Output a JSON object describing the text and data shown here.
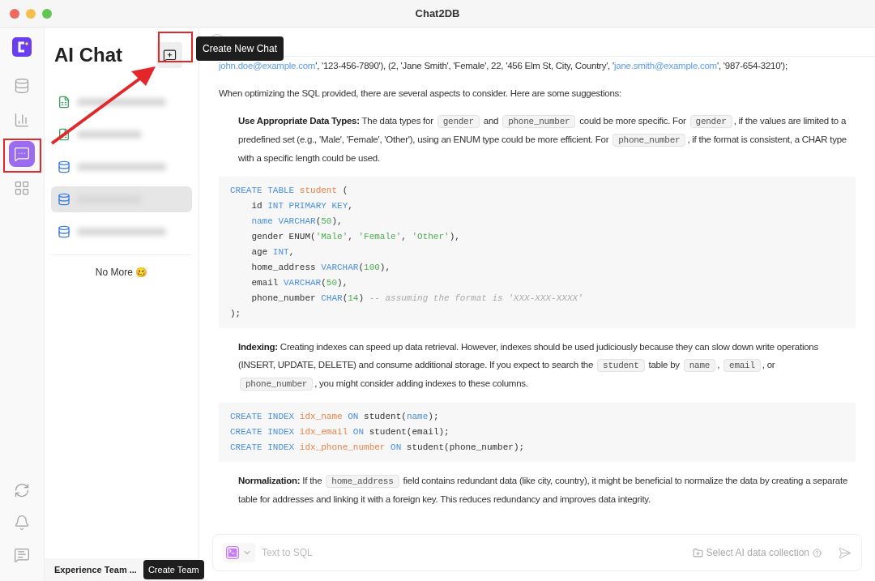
{
  "window": {
    "title": "Chat2DB"
  },
  "rail": {
    "top": [
      {
        "kind": "database",
        "selected": false
      },
      {
        "kind": "dashboard",
        "selected": false
      },
      {
        "kind": "chat",
        "selected": true
      },
      {
        "kind": "apps",
        "selected": false
      }
    ],
    "bottom": [
      {
        "kind": "sync",
        "selected": false
      },
      {
        "kind": "bell",
        "selected": false
      },
      {
        "kind": "feedback",
        "selected": false
      }
    ]
  },
  "sidebar": {
    "title": "AI Chat",
    "new_chat_tooltip": "Create New Chat",
    "items": [
      {
        "kind": "excel",
        "selected": false
      },
      {
        "kind": "excel",
        "selected": false
      },
      {
        "kind": "database",
        "selected": false
      },
      {
        "kind": "database",
        "selected": true
      },
      {
        "kind": "database",
        "selected": false
      }
    ],
    "end_note": "No More 🥴",
    "team": "Experience Team ...",
    "team_tooltip": "Create Team"
  },
  "messages": [
    {
      "kind": "text",
      "indent": false,
      "segments": [
        {
          "kind": "link",
          "text": "john.doe@example.com"
        },
        {
          "kind": "text",
          "text": "', '123-456-7890'), (2, 'Jane Smith', 'Female', 22, '456 Elm St, City, Country', '"
        },
        {
          "kind": "link",
          "text": "jane.smith@example.com"
        },
        {
          "kind": "text",
          "text": "', '987-654-3210');"
        }
      ]
    },
    {
      "kind": "text",
      "indent": false,
      "segments": [
        {
          "kind": "text",
          "text": "When optimizing the SQL provided, there are several aspects to consider. Here are some suggestions:"
        }
      ]
    },
    {
      "kind": "text",
      "indent": true,
      "segments": [
        {
          "kind": "bold",
          "text": "Use Appropriate Data Types:"
        },
        {
          "kind": "text",
          "text": " The data types for "
        },
        {
          "kind": "code",
          "text": "gender"
        },
        {
          "kind": "text",
          "text": " and "
        },
        {
          "kind": "code",
          "text": "phone_number"
        },
        {
          "kind": "text",
          "text": " could be more specific. For "
        },
        {
          "kind": "code",
          "text": "gender"
        },
        {
          "kind": "text",
          "text": ", if the values are limited to a predefined set (e.g., 'Male', 'Female', 'Other'), using an ENUM type could be more efficient. For "
        },
        {
          "kind": "code",
          "text": "phone_number"
        },
        {
          "kind": "text",
          "text": ", if the format is consistent, a CHAR type with a specific length could be used."
        }
      ]
    },
    {
      "kind": "code",
      "lines": [
        [
          {
            "kind": "kw",
            "text": "CREATE TABLE "
          },
          {
            "kind": "name",
            "text": "student"
          },
          {
            "kind": "plain",
            "text": " ("
          }
        ],
        [
          {
            "kind": "plain",
            "text": "    id "
          },
          {
            "kind": "kw",
            "text": "INT PRIMARY KEY"
          },
          {
            "kind": "plain",
            "text": ","
          }
        ],
        [
          {
            "kind": "kw",
            "text": "    name VARCHAR"
          },
          {
            "kind": "plain",
            "text": "("
          },
          {
            "kind": "num",
            "text": "50"
          },
          {
            "kind": "plain",
            "text": "),"
          }
        ],
        [
          {
            "kind": "plain",
            "text": "    gender ENUM("
          },
          {
            "kind": "str",
            "text": "'Male'"
          },
          {
            "kind": "plain",
            "text": ", "
          },
          {
            "kind": "str",
            "text": "'Female'"
          },
          {
            "kind": "plain",
            "text": ", "
          },
          {
            "kind": "str",
            "text": "'Other'"
          },
          {
            "kind": "plain",
            "text": "),"
          }
        ],
        [
          {
            "kind": "plain",
            "text": "    age "
          },
          {
            "kind": "kw",
            "text": "INT"
          },
          {
            "kind": "plain",
            "text": ","
          }
        ],
        [
          {
            "kind": "plain",
            "text": "    home_address "
          },
          {
            "kind": "kw",
            "text": "VARCHAR"
          },
          {
            "kind": "plain",
            "text": "("
          },
          {
            "kind": "num",
            "text": "100"
          },
          {
            "kind": "plain",
            "text": "),"
          }
        ],
        [
          {
            "kind": "plain",
            "text": "    email "
          },
          {
            "kind": "kw",
            "text": "VARCHAR"
          },
          {
            "kind": "plain",
            "text": "("
          },
          {
            "kind": "num",
            "text": "50"
          },
          {
            "kind": "plain",
            "text": "),"
          }
        ],
        [
          {
            "kind": "plain",
            "text": "    phone_number "
          },
          {
            "kind": "kw",
            "text": "CHAR"
          },
          {
            "kind": "plain",
            "text": "("
          },
          {
            "kind": "num",
            "text": "14"
          },
          {
            "kind": "plain",
            "text": ") "
          },
          {
            "kind": "cmt",
            "text": "-- assuming the format is 'XXX-XXX-XXXX'"
          }
        ],
        [
          {
            "kind": "plain",
            "text": ");"
          }
        ]
      ]
    },
    {
      "kind": "text",
      "indent": true,
      "segments": [
        {
          "kind": "bold",
          "text": "Indexing:"
        },
        {
          "kind": "text",
          "text": " Creating indexes can speed up data retrieval. However, indexes should be used judiciously because they can slow down write operations (INSERT, UPDATE, DELETE) and consume additional storage. If you expect to search the "
        },
        {
          "kind": "code",
          "text": "student"
        },
        {
          "kind": "text",
          "text": " table by "
        },
        {
          "kind": "code",
          "text": "name"
        },
        {
          "kind": "text",
          "text": ", "
        },
        {
          "kind": "code",
          "text": "email"
        },
        {
          "kind": "text",
          "text": ", or "
        },
        {
          "kind": "code",
          "text": "phone_number"
        },
        {
          "kind": "text",
          "text": ", you might consider adding indexes to these columns."
        }
      ]
    },
    {
      "kind": "code",
      "lines": [
        [
          {
            "kind": "kw",
            "text": "CREATE INDEX "
          },
          {
            "kind": "name",
            "text": "idx_name"
          },
          {
            "kind": "kw",
            "text": " ON"
          },
          {
            "kind": "plain",
            "text": " student("
          },
          {
            "kind": "kw",
            "text": "name"
          },
          {
            "kind": "plain",
            "text": ");"
          }
        ],
        [
          {
            "kind": "kw",
            "text": "CREATE INDEX "
          },
          {
            "kind": "name",
            "text": "idx_email"
          },
          {
            "kind": "kw",
            "text": " ON"
          },
          {
            "kind": "plain",
            "text": " student(email);"
          }
        ],
        [
          {
            "kind": "kw",
            "text": "CREATE INDEX "
          },
          {
            "kind": "name",
            "text": "idx_phone_number"
          },
          {
            "kind": "kw",
            "text": " ON"
          },
          {
            "kind": "plain",
            "text": " student(phone_number);"
          }
        ]
      ]
    },
    {
      "kind": "text",
      "indent": true,
      "segments": [
        {
          "kind": "bold",
          "text": "Normalization:"
        },
        {
          "kind": "text",
          "text": " If the "
        },
        {
          "kind": "code",
          "text": "home_address"
        },
        {
          "kind": "text",
          "text": " field contains redundant data (like city, country), it might be beneficial to normalize the data by creating a separate table for addresses and linking it with a foreign key. This reduces redundancy and improves data integrity."
        }
      ]
    }
  ],
  "composer": {
    "placeholder": "Text to SQL",
    "collection": "Select AI data collection"
  }
}
